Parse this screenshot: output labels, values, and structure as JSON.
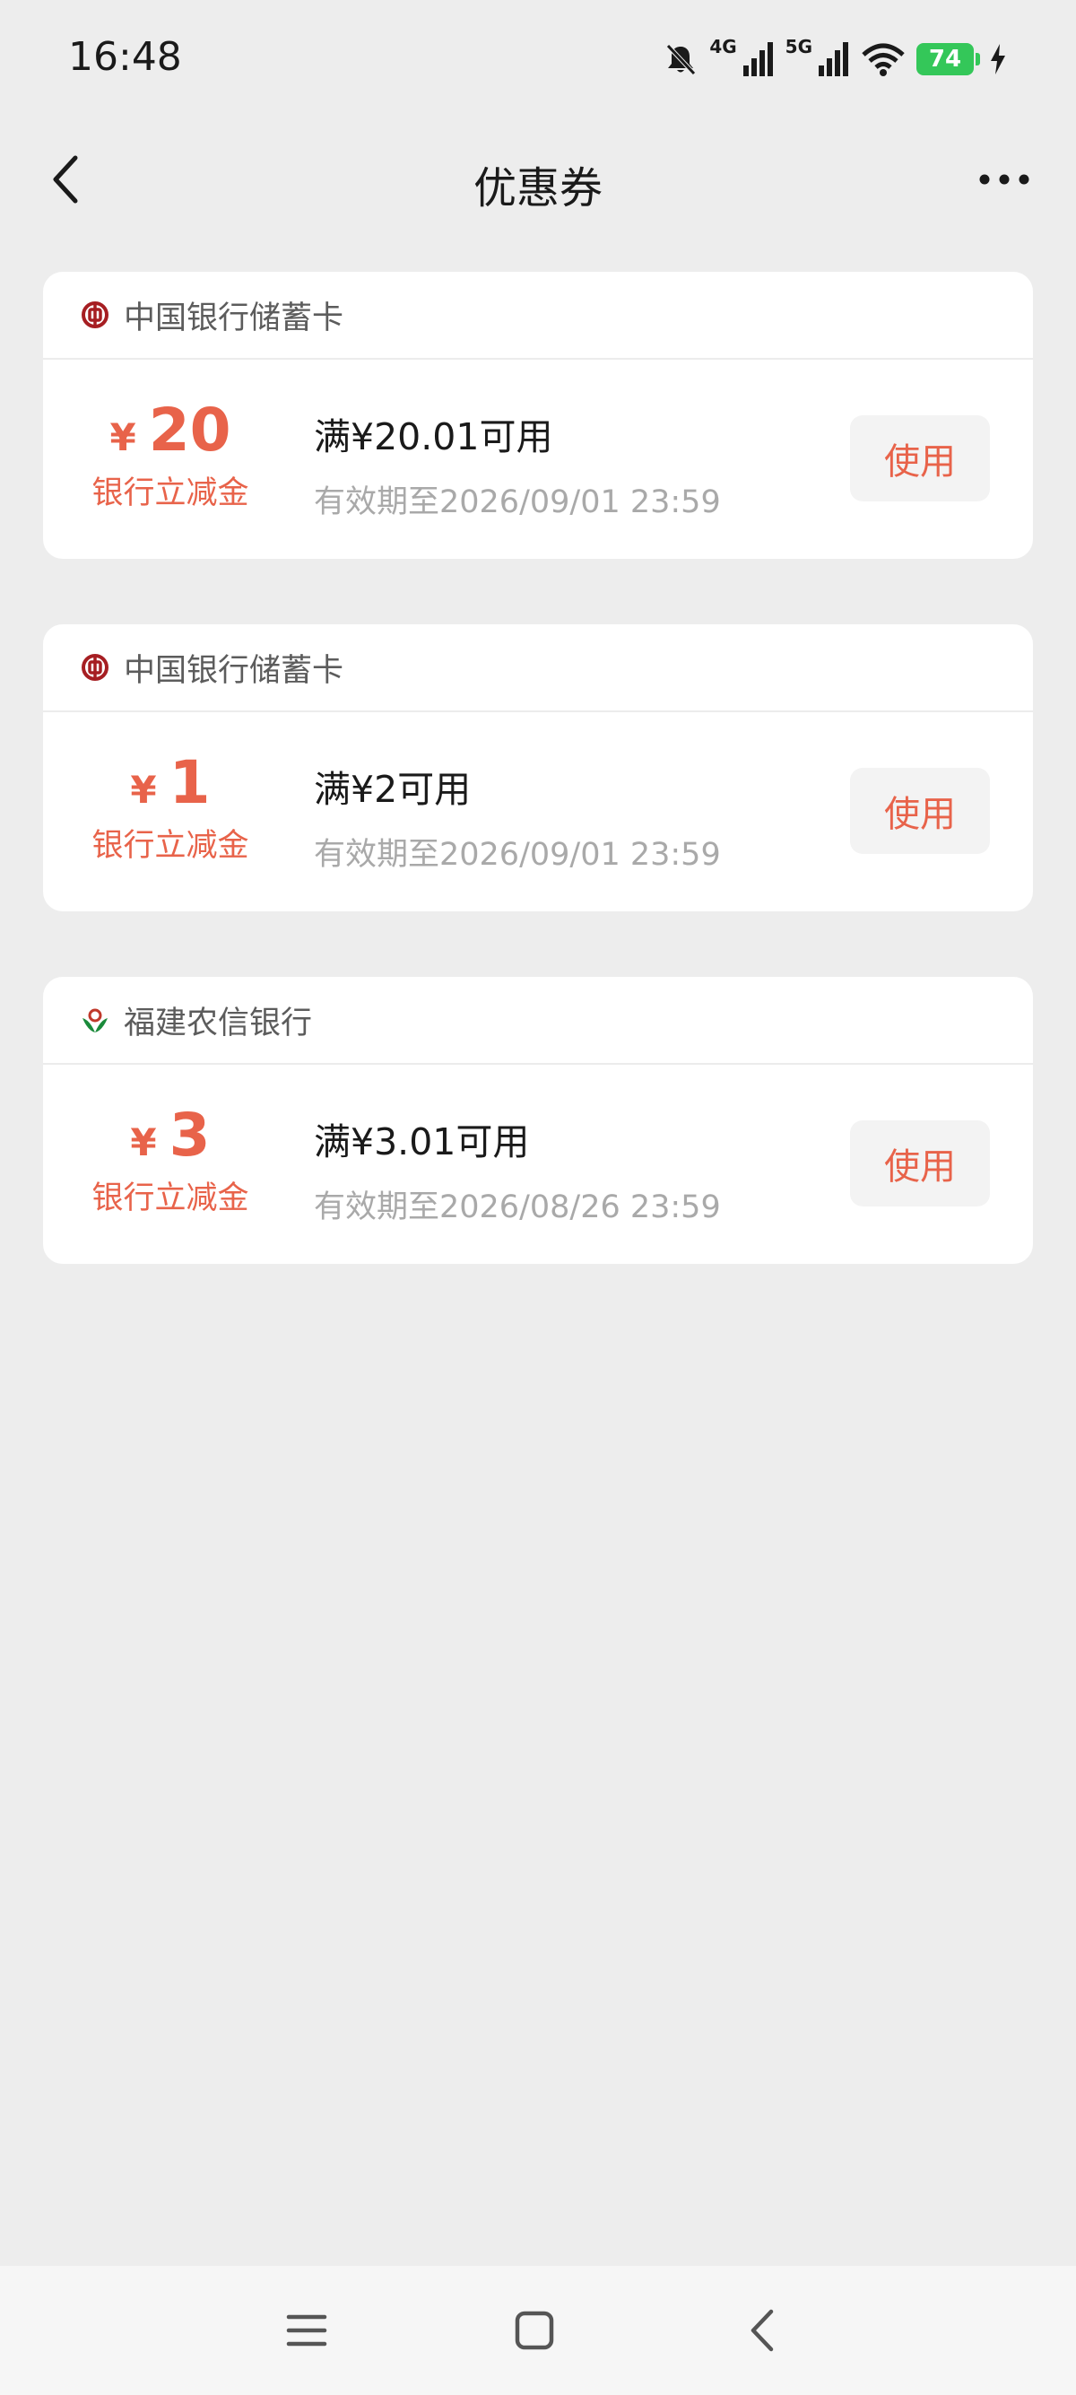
{
  "status_bar": {
    "time": "16:48",
    "network_1": "4G",
    "network_2": "5G",
    "battery": "74"
  },
  "header": {
    "title": "优惠券"
  },
  "coupons": [
    {
      "bank": "中国银行储蓄卡",
      "logo": "boc-logo-icon",
      "currency": "¥",
      "amount": "20",
      "amount_type": "银行立减金",
      "condition": "满¥20.01可用",
      "validity": "有效期至2026/09/01 23:59",
      "button_label": "使用"
    },
    {
      "bank": "中国银行储蓄卡",
      "logo": "boc-logo-icon",
      "currency": "¥",
      "amount": "1",
      "amount_type": "银行立减金",
      "condition": "满¥2可用",
      "validity": "有效期至2026/09/01 23:59",
      "button_label": "使用"
    },
    {
      "bank": "福建农信银行",
      "logo": "fjnx-logo-icon",
      "currency": "¥",
      "amount": "3",
      "amount_type": "银行立减金",
      "condition": "满¥3.01可用",
      "validity": "有效期至2026/08/26 23:59",
      "button_label": "使用"
    }
  ],
  "colors": {
    "accent": "#e8634a",
    "background": "#ededed",
    "card": "#ffffff",
    "boc_red": "#a61e22",
    "fjnx_green": "#1a8a3a",
    "battery_green": "#34c759"
  }
}
